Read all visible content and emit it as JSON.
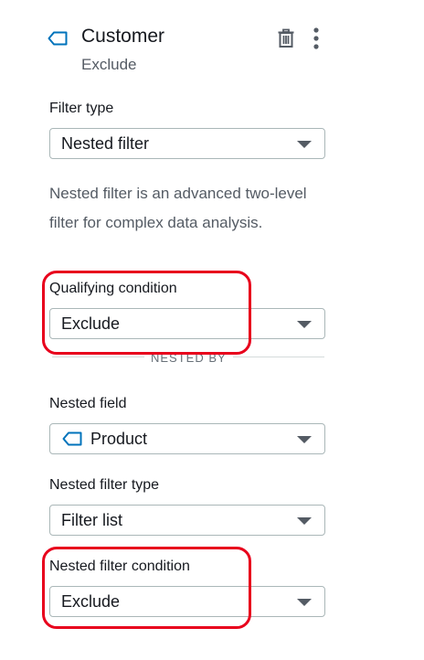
{
  "header": {
    "title": "Customer",
    "subtitle": "Exclude",
    "icons": {
      "field": "dimension-tag-icon",
      "delete": "trash-icon",
      "more": "more-vertical-icon"
    }
  },
  "filter_type": {
    "label": "Filter type",
    "value": "Nested filter"
  },
  "description": "Nested filter is an advanced two-level filter for complex data analysis.",
  "qualifying_condition": {
    "label": "Qualifying condition",
    "value": "Exclude"
  },
  "divider": {
    "label": "NESTED BY"
  },
  "nested_field": {
    "label": "Nested field",
    "value": "Product"
  },
  "nested_filter_type": {
    "label": "Nested filter type",
    "value": "Filter list"
  },
  "nested_filter_condition": {
    "label": "Nested filter condition",
    "value": "Exclude"
  },
  "colors": {
    "accent": "#0073bb",
    "highlight": "#e8001c",
    "text": "#16191f",
    "secondary_text": "#545b64"
  }
}
